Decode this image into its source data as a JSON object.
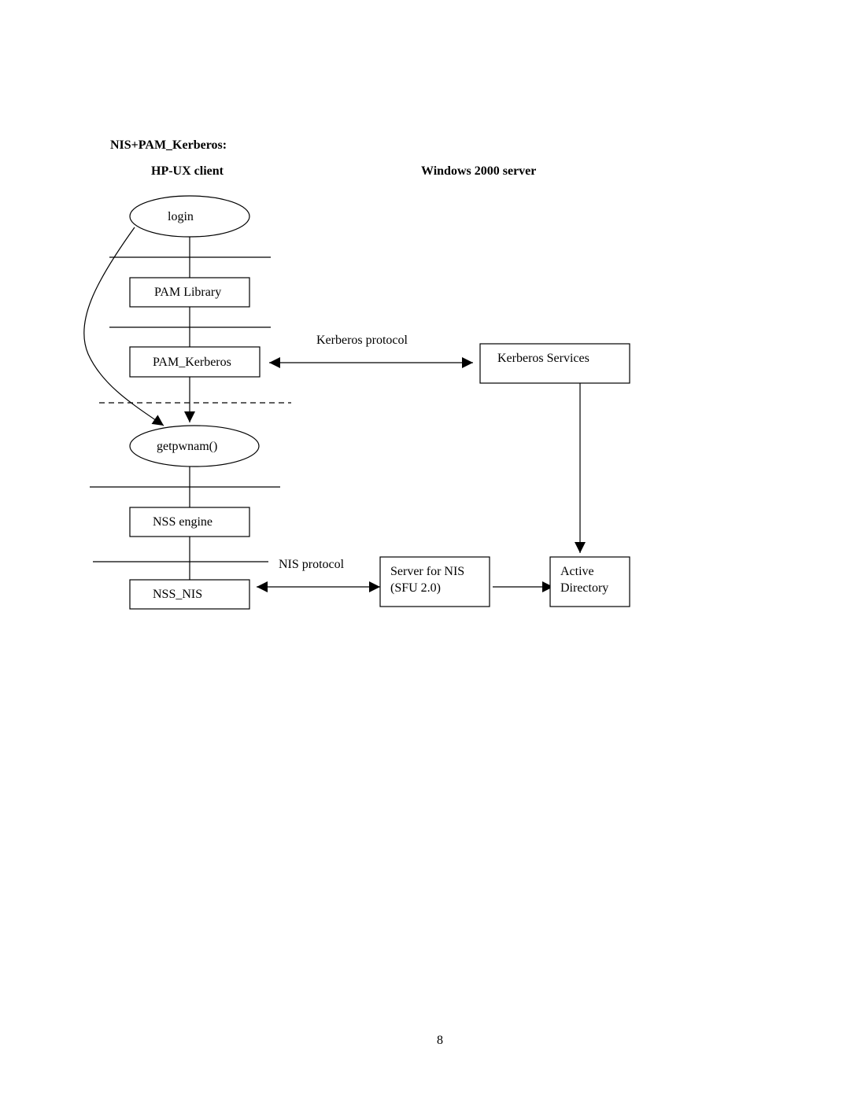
{
  "title": "NIS+PAM_Kerberos:",
  "columns": {
    "client": "HP-UX client",
    "server": "Windows 2000 server"
  },
  "nodes": {
    "login": "login",
    "pam_library": "PAM Library",
    "pam_kerberos": "PAM_Kerberos",
    "getpwnam": "getpwnam()",
    "nss_engine": "NSS engine",
    "nss_nis": "NSS_NIS",
    "kerberos_services": "Kerberos Services",
    "server_for_nis_line1": "Server for NIS",
    "server_for_nis_line2": "(SFU 2.0)",
    "active_directory_line1": "Active",
    "active_directory_line2": "Directory"
  },
  "edges": {
    "kerberos_protocol": "Kerberos protocol",
    "nis_protocol": "NIS protocol"
  },
  "page_number": "8"
}
